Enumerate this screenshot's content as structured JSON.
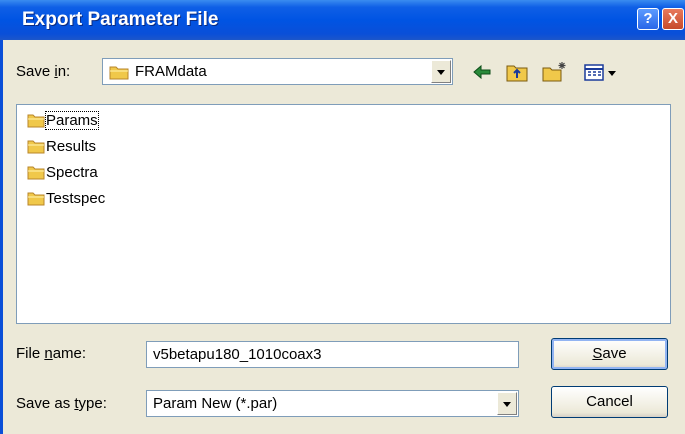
{
  "window": {
    "title": "Export Parameter File",
    "help_label": "?",
    "close_label": "X"
  },
  "save_in": {
    "label_pre": "Save ",
    "label_accel": "i",
    "label_post": "n:",
    "value": "FRAMdata"
  },
  "toolbar": {
    "icons": [
      "back-arrow-icon",
      "up-folder-icon",
      "new-folder-icon",
      "view-menu-icon"
    ]
  },
  "files": [
    {
      "name": "Params"
    },
    {
      "name": "Results"
    },
    {
      "name": "Spectra"
    },
    {
      "name": "Testspec"
    }
  ],
  "file_name": {
    "label_pre": "File ",
    "label_accel": "n",
    "label_post": "ame:",
    "value": "v5betapu180_1010coax3"
  },
  "save_as_type": {
    "label_pre": "Save as ",
    "label_accel": "t",
    "label_post": "ype:",
    "value": "Param New (*.par)"
  },
  "buttons": {
    "save_accel": "S",
    "save_rest": "ave",
    "cancel": "Cancel"
  },
  "colors": {
    "titlebar": "#0054e3",
    "dialog_bg": "#ece9d8",
    "folder": "#f0c84a"
  }
}
